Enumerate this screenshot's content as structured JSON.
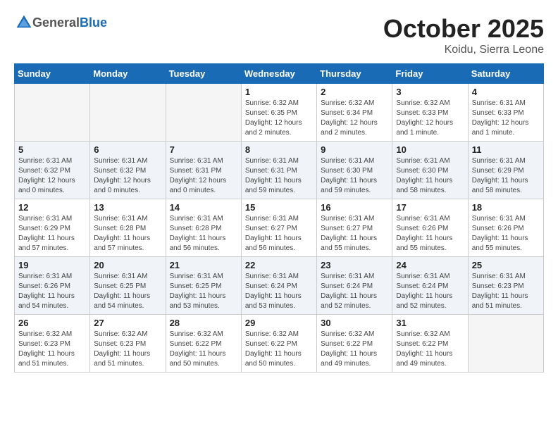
{
  "header": {
    "logo_general": "General",
    "logo_blue": "Blue",
    "month": "October 2025",
    "location": "Koidu, Sierra Leone"
  },
  "weekdays": [
    "Sunday",
    "Monday",
    "Tuesday",
    "Wednesday",
    "Thursday",
    "Friday",
    "Saturday"
  ],
  "weeks": [
    [
      {
        "day": "",
        "info": ""
      },
      {
        "day": "",
        "info": ""
      },
      {
        "day": "",
        "info": ""
      },
      {
        "day": "1",
        "info": "Sunrise: 6:32 AM\nSunset: 6:35 PM\nDaylight: 12 hours\nand 2 minutes."
      },
      {
        "day": "2",
        "info": "Sunrise: 6:32 AM\nSunset: 6:34 PM\nDaylight: 12 hours\nand 2 minutes."
      },
      {
        "day": "3",
        "info": "Sunrise: 6:32 AM\nSunset: 6:33 PM\nDaylight: 12 hours\nand 1 minute."
      },
      {
        "day": "4",
        "info": "Sunrise: 6:31 AM\nSunset: 6:33 PM\nDaylight: 12 hours\nand 1 minute."
      }
    ],
    [
      {
        "day": "5",
        "info": "Sunrise: 6:31 AM\nSunset: 6:32 PM\nDaylight: 12 hours\nand 0 minutes."
      },
      {
        "day": "6",
        "info": "Sunrise: 6:31 AM\nSunset: 6:32 PM\nDaylight: 12 hours\nand 0 minutes."
      },
      {
        "day": "7",
        "info": "Sunrise: 6:31 AM\nSunset: 6:31 PM\nDaylight: 12 hours\nand 0 minutes."
      },
      {
        "day": "8",
        "info": "Sunrise: 6:31 AM\nSunset: 6:31 PM\nDaylight: 11 hours\nand 59 minutes."
      },
      {
        "day": "9",
        "info": "Sunrise: 6:31 AM\nSunset: 6:30 PM\nDaylight: 11 hours\nand 59 minutes."
      },
      {
        "day": "10",
        "info": "Sunrise: 6:31 AM\nSunset: 6:30 PM\nDaylight: 11 hours\nand 58 minutes."
      },
      {
        "day": "11",
        "info": "Sunrise: 6:31 AM\nSunset: 6:29 PM\nDaylight: 11 hours\nand 58 minutes."
      }
    ],
    [
      {
        "day": "12",
        "info": "Sunrise: 6:31 AM\nSunset: 6:29 PM\nDaylight: 11 hours\nand 57 minutes."
      },
      {
        "day": "13",
        "info": "Sunrise: 6:31 AM\nSunset: 6:28 PM\nDaylight: 11 hours\nand 57 minutes."
      },
      {
        "day": "14",
        "info": "Sunrise: 6:31 AM\nSunset: 6:28 PM\nDaylight: 11 hours\nand 56 minutes."
      },
      {
        "day": "15",
        "info": "Sunrise: 6:31 AM\nSunset: 6:27 PM\nDaylight: 11 hours\nand 56 minutes."
      },
      {
        "day": "16",
        "info": "Sunrise: 6:31 AM\nSunset: 6:27 PM\nDaylight: 11 hours\nand 55 minutes."
      },
      {
        "day": "17",
        "info": "Sunrise: 6:31 AM\nSunset: 6:26 PM\nDaylight: 11 hours\nand 55 minutes."
      },
      {
        "day": "18",
        "info": "Sunrise: 6:31 AM\nSunset: 6:26 PM\nDaylight: 11 hours\nand 55 minutes."
      }
    ],
    [
      {
        "day": "19",
        "info": "Sunrise: 6:31 AM\nSunset: 6:26 PM\nDaylight: 11 hours\nand 54 minutes."
      },
      {
        "day": "20",
        "info": "Sunrise: 6:31 AM\nSunset: 6:25 PM\nDaylight: 11 hours\nand 54 minutes."
      },
      {
        "day": "21",
        "info": "Sunrise: 6:31 AM\nSunset: 6:25 PM\nDaylight: 11 hours\nand 53 minutes."
      },
      {
        "day": "22",
        "info": "Sunrise: 6:31 AM\nSunset: 6:24 PM\nDaylight: 11 hours\nand 53 minutes."
      },
      {
        "day": "23",
        "info": "Sunrise: 6:31 AM\nSunset: 6:24 PM\nDaylight: 11 hours\nand 52 minutes."
      },
      {
        "day": "24",
        "info": "Sunrise: 6:31 AM\nSunset: 6:24 PM\nDaylight: 11 hours\nand 52 minutes."
      },
      {
        "day": "25",
        "info": "Sunrise: 6:31 AM\nSunset: 6:23 PM\nDaylight: 11 hours\nand 51 minutes."
      }
    ],
    [
      {
        "day": "26",
        "info": "Sunrise: 6:32 AM\nSunset: 6:23 PM\nDaylight: 11 hours\nand 51 minutes."
      },
      {
        "day": "27",
        "info": "Sunrise: 6:32 AM\nSunset: 6:23 PM\nDaylight: 11 hours\nand 51 minutes."
      },
      {
        "day": "28",
        "info": "Sunrise: 6:32 AM\nSunset: 6:22 PM\nDaylight: 11 hours\nand 50 minutes."
      },
      {
        "day": "29",
        "info": "Sunrise: 6:32 AM\nSunset: 6:22 PM\nDaylight: 11 hours\nand 50 minutes."
      },
      {
        "day": "30",
        "info": "Sunrise: 6:32 AM\nSunset: 6:22 PM\nDaylight: 11 hours\nand 49 minutes."
      },
      {
        "day": "31",
        "info": "Sunrise: 6:32 AM\nSunset: 6:22 PM\nDaylight: 11 hours\nand 49 minutes."
      },
      {
        "day": "",
        "info": ""
      }
    ]
  ]
}
